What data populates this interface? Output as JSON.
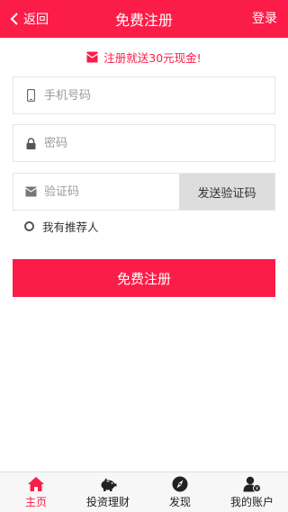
{
  "header": {
    "back_label": "返回",
    "title": "免费注册",
    "login_label": "登录"
  },
  "promo": {
    "text": "注册就送30元现金!"
  },
  "form": {
    "phone_placeholder": "手机号码",
    "password_placeholder": "密码",
    "code_placeholder": "验证码",
    "send_code_label": "发送验证码",
    "referrer_label": "我有推荐人",
    "submit_label": "免费注册"
  },
  "tabs": [
    {
      "label": "主页",
      "icon": "home-icon",
      "active": true
    },
    {
      "label": "投资理财",
      "icon": "piggy-bank-icon",
      "active": false
    },
    {
      "label": "发现",
      "icon": "compass-icon",
      "active": false
    },
    {
      "label": "我的账户",
      "icon": "user-account-icon",
      "active": false
    }
  ],
  "colors": {
    "primary": "#fb1d48",
    "button_gray": "#dddddd",
    "tabbar_bg": "#f7f7f7"
  }
}
